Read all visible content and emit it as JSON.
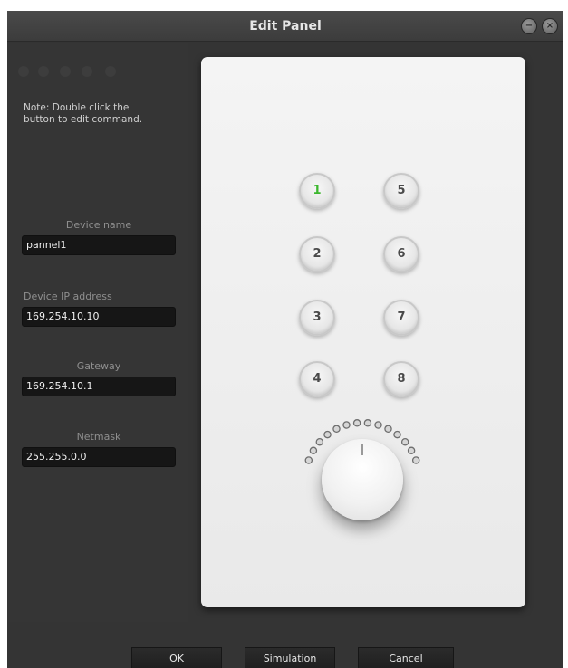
{
  "window": {
    "title": "Edit Panel",
    "minimize_glyph": "−",
    "close_glyph": "×"
  },
  "left_panel": {
    "note": "Note: Double click the button to edit command.",
    "fields": {
      "device_name": {
        "label": "Device name",
        "value": "pannel1"
      },
      "device_ip": {
        "label": "Device IP address",
        "value": "169.254.10.10"
      },
      "gateway": {
        "label": "Gateway",
        "value": "169.254.10.1"
      },
      "netmask": {
        "label": "Netmask",
        "value": "255.255.0.0"
      }
    }
  },
  "panel": {
    "buttons": [
      "1",
      "2",
      "3",
      "4",
      "5",
      "6",
      "7",
      "8"
    ],
    "active_button": "1",
    "active_color": "#3cb72e",
    "knob_leds": 14
  },
  "footer": {
    "ok": "OK",
    "simulation": "Simulation",
    "cancel": "Cancel"
  }
}
